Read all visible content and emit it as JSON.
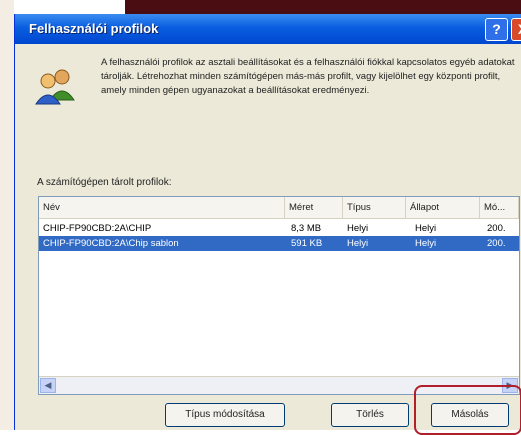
{
  "window": {
    "title": "Felhasználói profilok",
    "help_label": "?",
    "close_label": "X"
  },
  "description": "A felhasználói profilok az asztali beállításokat és a felhasználói fiókkal kapcsolatos egyéb adatokat tárolják. Létrehozhat minden számítógépen más-más profilt, vagy kijelölhet egy központi profilt, amely minden gépen ugyanazokat a beállításokat eredményezi.",
  "profiles_label": "A számítógépen tárolt profilok:",
  "list": {
    "columns": [
      "Név",
      "Méret",
      "Típus",
      "Állapot",
      "Mó..."
    ],
    "rows": [
      {
        "name": "CHIP-FP90CBD:2A\\CHIP",
        "size": "8,3 MB",
        "type": "Helyi",
        "status": "Helyi",
        "modified": "200.",
        "selected": false
      },
      {
        "name": "CHIP-FP90CBD:2A\\Chip sablon",
        "size": "591 KB",
        "type": "Helyi",
        "status": "Helyi",
        "modified": "200.",
        "selected": true
      }
    ]
  },
  "scrollbar": {
    "left_icon": "scroll-left-icon",
    "right_icon": "scroll-right-icon"
  },
  "buttons": {
    "change_type": "Típus módosítása",
    "delete": "Törlés",
    "copy": "Másolás"
  },
  "colors": {
    "titlebar": "#0a5ee0",
    "selection": "#316ac5",
    "highlight_frame": "#b01f2a",
    "background_dark": "#4a0d12"
  }
}
